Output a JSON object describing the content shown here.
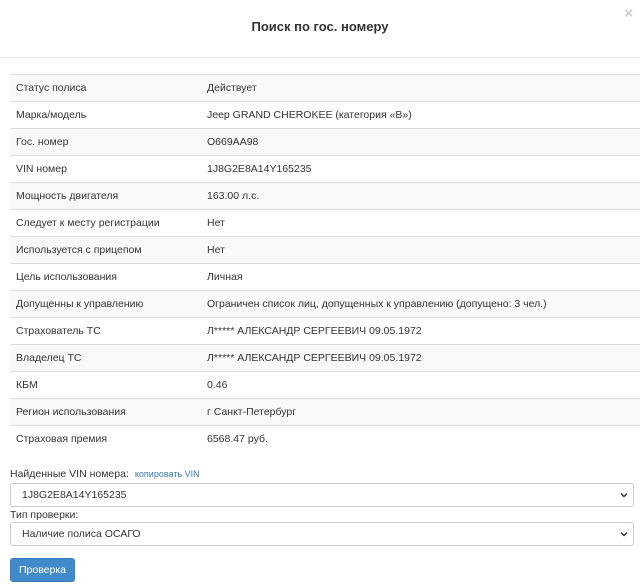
{
  "modal": {
    "title": "Поиск по гос. номеру",
    "close_icon": "×"
  },
  "policy_rows": [
    {
      "label": "Статус полиса",
      "value": "Действует"
    },
    {
      "label": "Марка/модель",
      "value": "Jeep GRAND CHEROKEE (категория «B»)"
    },
    {
      "label": "Гос. номер",
      "value": "О669АА98"
    },
    {
      "label": "VIN номер",
      "value": "1J8G2E8A14Y165235"
    },
    {
      "label": "Мощность двигателя",
      "value": "163.00 л.с."
    },
    {
      "label": "Следует к месту регистрации",
      "value": "Нет"
    },
    {
      "label": "Используется с прицепом",
      "value": "Нет"
    },
    {
      "label": "Цель использования",
      "value": "Личная"
    },
    {
      "label": "Допущенны к управлению",
      "value": "Ограничен список лиц, допущенных к управлению (допущено: 3 чел.)"
    },
    {
      "label": "Страхователь ТС",
      "value": "Л***** АЛЕКСАНДР СЕРГЕЕВИЧ 09.05.1972"
    },
    {
      "label": "Владелец ТС",
      "value": "Л***** АЛЕКСАНДР СЕРГЕЕВИЧ 09.05.1972"
    },
    {
      "label": "КБМ",
      "value": "0.46"
    },
    {
      "label": "Регион использования",
      "value": "г Санкт-Петербург"
    },
    {
      "label": "Страховая премия",
      "value": "6568.47 руб."
    }
  ],
  "vin_section": {
    "label": "Найденные VIN номера:",
    "copy_link": "копировать VIN",
    "selected": "1J8G2E8A14Y165235"
  },
  "check_type": {
    "label": "Тип проверки:",
    "selected": "Наличие полиса ОСАГО"
  },
  "submit": {
    "label": "Проверка"
  }
}
